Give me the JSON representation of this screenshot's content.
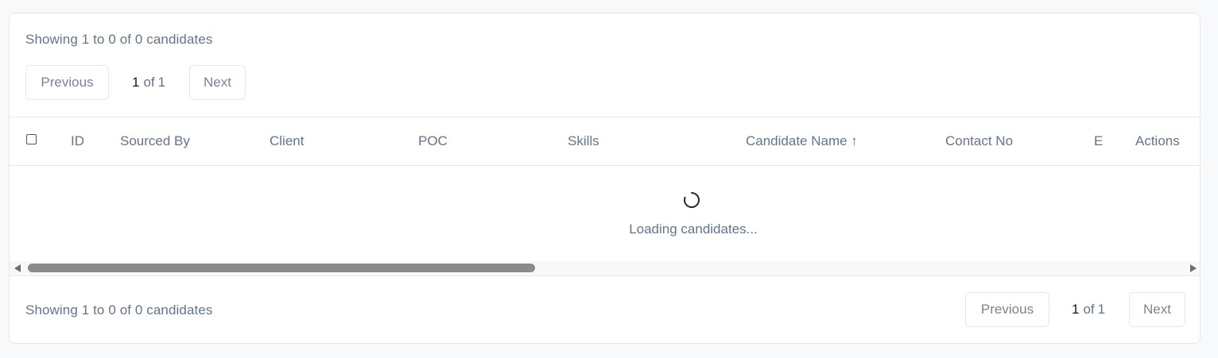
{
  "top": {
    "summary": "Showing 1 to 0 of 0 candidates",
    "previous_label": "Previous",
    "current_page": "1",
    "page_of": "of",
    "total_pages": "1",
    "next_label": "Next"
  },
  "table": {
    "columns": [
      "ID",
      "Sourced By",
      "Client",
      "POC",
      "Skills",
      "Candidate Name ↑",
      "Contact No",
      "E",
      "Actions"
    ],
    "loading_text": "Loading candidates..."
  },
  "bottom": {
    "summary": "Showing 1 to 0 of 0 candidates",
    "previous_label": "Previous",
    "current_page": "1",
    "page_of": "of",
    "total_pages": "1",
    "next_label": "Next"
  },
  "icons": {
    "spinner": "loading-spinner-icon",
    "scroll_left": "scroll-left-arrow-icon",
    "scroll_right": "scroll-right-arrow-icon"
  },
  "colors": {
    "text_muted": "#64748b",
    "text_strong": "#0f172a",
    "border": "#e6e8ec",
    "spinner": "#1e293b"
  }
}
